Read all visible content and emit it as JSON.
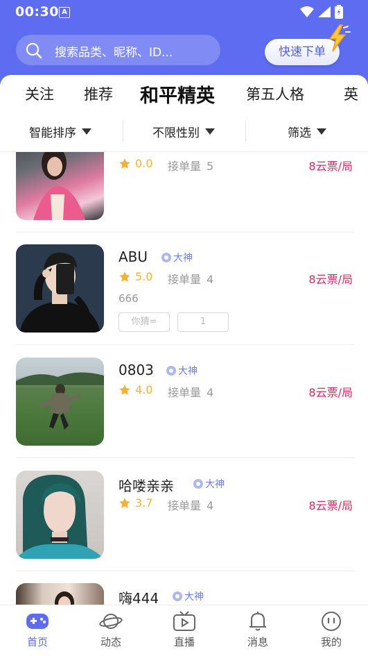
{
  "status_bar": {
    "time": "00:30",
    "notif_letter": "A"
  },
  "search": {
    "placeholder": "搜索品类、昵称、ID..."
  },
  "quick_order": {
    "label": "快速下单"
  },
  "tabs": [
    {
      "label": "关注"
    },
    {
      "label": "推荐"
    },
    {
      "label": "和平精英",
      "active": true
    },
    {
      "label": "第五人格"
    },
    {
      "label": "英"
    }
  ],
  "filters": [
    {
      "label": "智能排序"
    },
    {
      "label": "不限性别"
    },
    {
      "label": "筛选"
    }
  ],
  "list": [
    {
      "name": "",
      "badge": "",
      "rating": "0.0",
      "orders_label": "接单量",
      "orders": "5",
      "price": "8云票/局"
    },
    {
      "name": "ABU",
      "badge": "大神",
      "rating": "5.0",
      "orders_label": "接单量",
      "orders": "4",
      "price": "8云票/局",
      "desc": "666",
      "tags": [
        "你猜=",
        "1"
      ]
    },
    {
      "name": "0803",
      "badge": "大神",
      "rating": "4.0",
      "orders_label": "接单量",
      "orders": "4",
      "price": "8云票/局"
    },
    {
      "name": "哈喽亲亲",
      "badge": "大神",
      "rating": "3.7",
      "orders_label": "接单量",
      "orders": "4",
      "price": "8云票/局"
    },
    {
      "name": "嗨444",
      "badge": "大神"
    }
  ],
  "bottom_nav": [
    {
      "label": "首页",
      "icon": "gamepad-icon",
      "active": true
    },
    {
      "label": "动态",
      "icon": "planet-icon"
    },
    {
      "label": "直播",
      "icon": "tv-icon"
    },
    {
      "label": "消息",
      "icon": "bell-icon"
    },
    {
      "label": "我的",
      "icon": "smile-face-icon"
    }
  ],
  "colors": {
    "brand": "#5d6cf0",
    "price": "#e2245a",
    "star": "#f2b233"
  }
}
